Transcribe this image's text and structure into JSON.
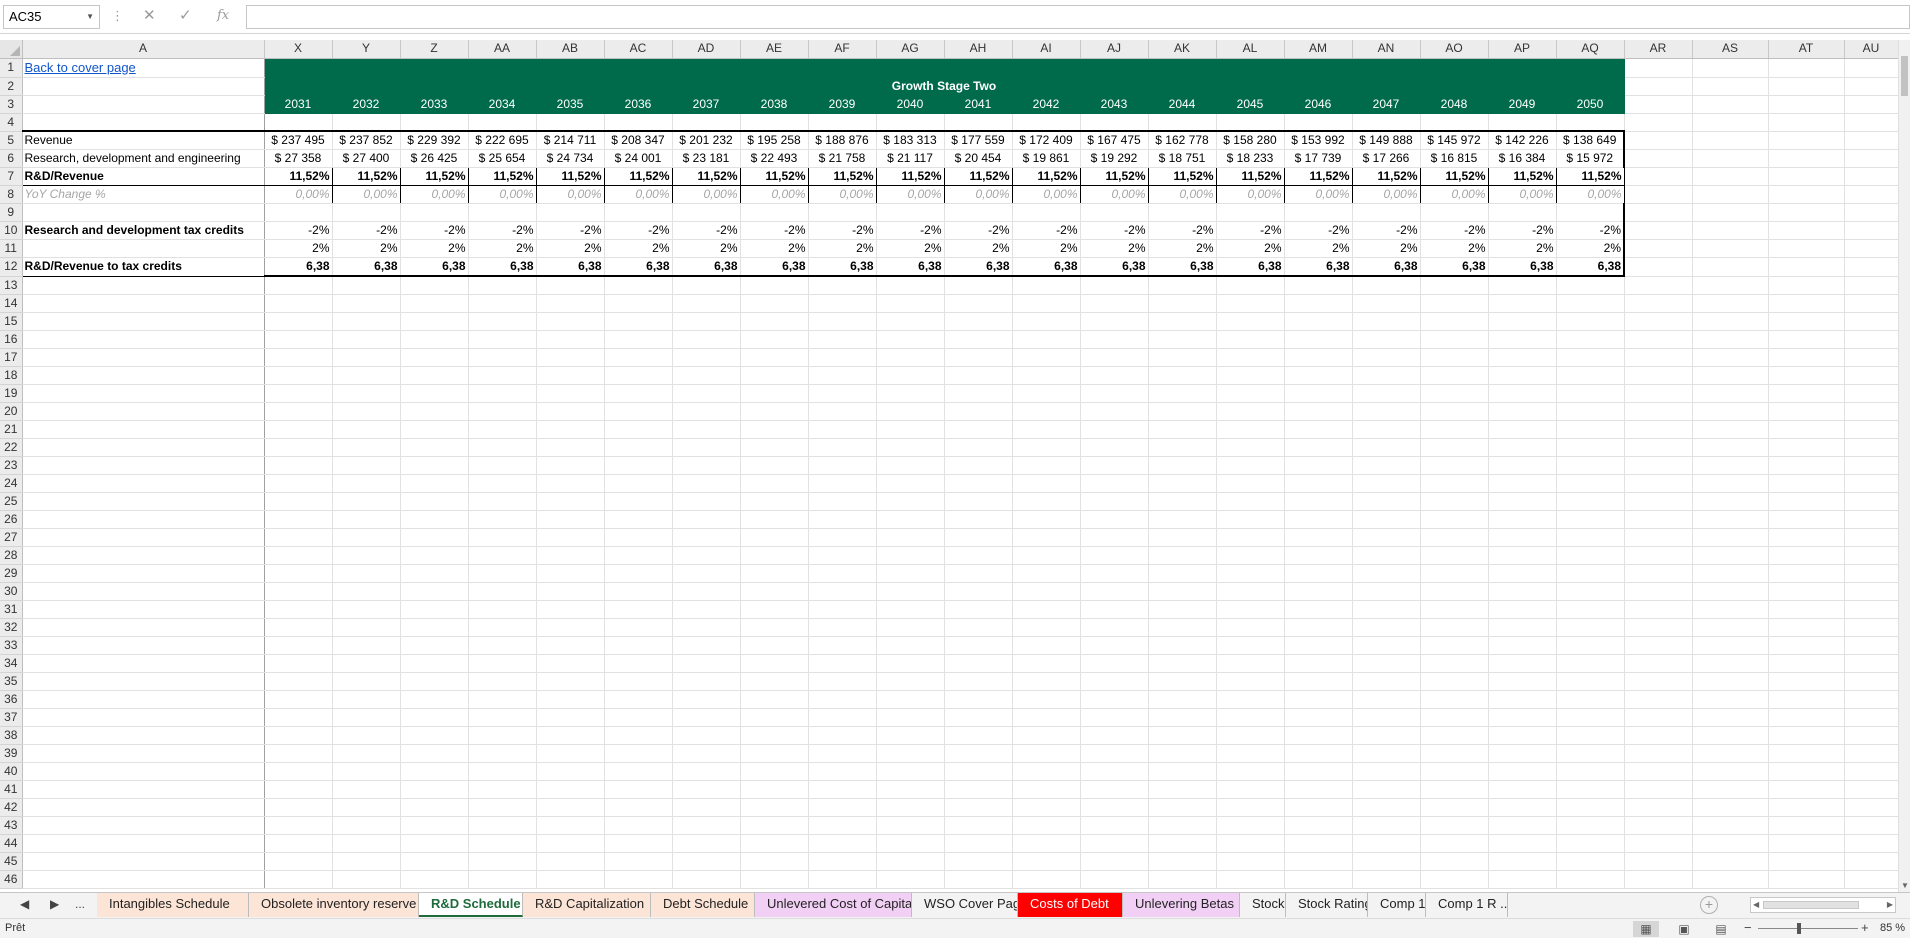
{
  "formula_bar": {
    "cell_ref": "AC35",
    "formula": ""
  },
  "columns": [
    "A",
    "X",
    "Y",
    "Z",
    "AA",
    "AB",
    "AC",
    "AD",
    "AE",
    "AF",
    "AG",
    "AH",
    "AI",
    "AJ",
    "AK",
    "AL",
    "AM",
    "AN",
    "AO",
    "AP",
    "AQ",
    "AR",
    "AS",
    "AT",
    "AU"
  ],
  "sheet": {
    "back_link": "Back to cover page ",
    "banner": "Growth Stage Two",
    "years": [
      "2031",
      "2032",
      "2033",
      "2034",
      "2035",
      "2036",
      "2037",
      "2038",
      "2039",
      "2040",
      "2041",
      "2042",
      "2043",
      "2044",
      "2045",
      "2046",
      "2047",
      "2048",
      "2049",
      "2050"
    ],
    "rows": {
      "revenue": {
        "label": "Revenue",
        "values": [
          "$ 237 495",
          "$ 237 852",
          "$ 229 392",
          "$ 222 695",
          "$ 214 711",
          "$ 208 347",
          "$ 201 232",
          "$ 195 258",
          "$ 188 876",
          "$ 183 313",
          "$ 177 559",
          "$ 172 409",
          "$ 167 475",
          "$ 162 778",
          "$ 158 280",
          "$ 153 992",
          "$ 149 888",
          "$ 145 972",
          "$ 142 226",
          "$ 138 649"
        ]
      },
      "rde": {
        "label": "Research, development and engineering",
        "values": [
          "$  27 358",
          "$  27 400",
          "$  26 425",
          "$  25 654",
          "$  24 734",
          "$  24 001",
          "$  23 181",
          "$  22 493",
          "$  21 758",
          "$  21 117",
          "$  20 454",
          "$  19 861",
          "$  19 292",
          "$  18 751",
          "$  18 233",
          "$  17 739",
          "$  17 266",
          "$  16 815",
          "$  16 384",
          "$  15 972"
        ]
      },
      "rd_revenue": {
        "label": "R&D/Revenue",
        "values": [
          "11,52%",
          "11,52%",
          "11,52%",
          "11,52%",
          "11,52%",
          "11,52%",
          "11,52%",
          "11,52%",
          "11,52%",
          "11,52%",
          "11,52%",
          "11,52%",
          "11,52%",
          "11,52%",
          "11,52%",
          "11,52%",
          "11,52%",
          "11,52%",
          "11,52%",
          "11,52%"
        ]
      },
      "yoy": {
        "label": "YoY Change %",
        "values": [
          "0,00%",
          "0,00%",
          "0,00%",
          "0,00%",
          "0,00%",
          "0,00%",
          "0,00%",
          "0,00%",
          "0,00%",
          "0,00%",
          "0,00%",
          "0,00%",
          "0,00%",
          "0,00%",
          "0,00%",
          "0,00%",
          "0,00%",
          "0,00%",
          "0,00%",
          "0,00%"
        ]
      },
      "tax_credits": {
        "label": "Research and development tax credits",
        "values": [
          "-2%",
          "-2%",
          "-2%",
          "-2%",
          "-2%",
          "-2%",
          "-2%",
          "-2%",
          "-2%",
          "-2%",
          "-2%",
          "-2%",
          "-2%",
          "-2%",
          "-2%",
          "-2%",
          "-2%",
          "-2%",
          "-2%",
          "-2%"
        ]
      },
      "row11": {
        "values": [
          "2%",
          "2%",
          "2%",
          "2%",
          "2%",
          "2%",
          "2%",
          "2%",
          "2%",
          "2%",
          "2%",
          "2%",
          "2%",
          "2%",
          "2%",
          "2%",
          "2%",
          "2%",
          "2%",
          "2%"
        ]
      },
      "ratio": {
        "label": "R&D/Revenue to tax credits",
        "values": [
          "6,38",
          "6,38",
          "6,38",
          "6,38",
          "6,38",
          "6,38",
          "6,38",
          "6,38",
          "6,38",
          "6,38",
          "6,38",
          "6,38",
          "6,38",
          "6,38",
          "6,38",
          "6,38",
          "6,38",
          "6,38",
          "6,38",
          "6,38"
        ]
      }
    }
  },
  "tabs": {
    "more": "...",
    "items": [
      {
        "label": "Intangibles Schedule",
        "color": "#fce4d6"
      },
      {
        "label": "Obsolete inventory reserve",
        "color": "#fce4d6"
      },
      {
        "label": "R&D Schedule",
        "color": "#ffffff",
        "active": true
      },
      {
        "label": "R&D Capitalization",
        "color": "#fce4d6"
      },
      {
        "label": "Debt Schedule",
        "color": "#fce4d6"
      },
      {
        "label": "Unlevered Cost of Capital",
        "color": "#f2d0f5"
      },
      {
        "label": "WSO Cover Page",
        "color": "#f3f3f3"
      },
      {
        "label": "Costs of Debt",
        "color": "#ff0000"
      },
      {
        "label": "Unlevering Betas",
        "color": "#f2d0f5"
      },
      {
        "label": "Stock",
        "color": "#f3f3f3"
      },
      {
        "label": "Stock Rating",
        "color": "#f3f3f3"
      },
      {
        "label": "Comp 1",
        "color": "#f3f3f3"
      },
      {
        "label": "Comp 1 R ...",
        "color": "#f3f3f3"
      }
    ]
  },
  "status": {
    "ready": "Prêt",
    "zoom": "85 %"
  }
}
